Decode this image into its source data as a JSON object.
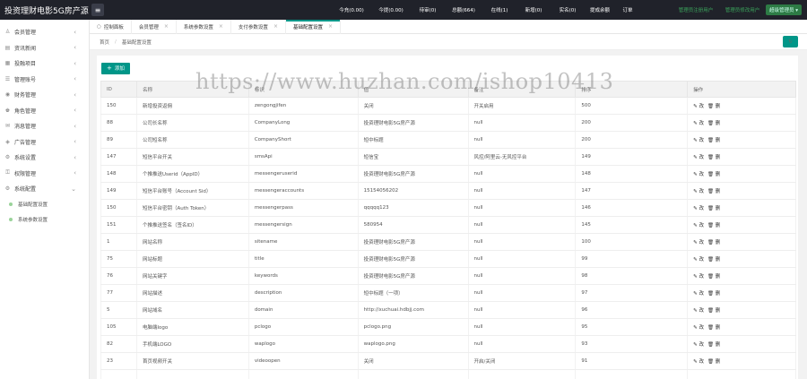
{
  "app": {
    "title": "投资理财电影5G房产源"
  },
  "topbar": {
    "stats": [
      {
        "label": "今充(0.00)"
      },
      {
        "label": "今提(0.00)"
      },
      {
        "label": "待审(0)"
      },
      {
        "label": "总额(664)"
      },
      {
        "label": "在线(1)"
      },
      {
        "label": "新增(0)"
      },
      {
        "label": "实名(0)"
      },
      {
        "label": "提成余额"
      },
      {
        "label": "订单"
      }
    ],
    "green_links": [
      "管理员注册用户",
      "管理员修改用户"
    ],
    "user": "超级管理员"
  },
  "sidebar": {
    "items": [
      {
        "label": "会员管理",
        "icon": "user-icon"
      },
      {
        "label": "资讯新闻",
        "icon": "news-icon"
      },
      {
        "label": "投融项目",
        "icon": "project-icon"
      },
      {
        "label": "管理账号",
        "icon": "account-icon"
      },
      {
        "label": "财务管理",
        "icon": "finance-icon"
      },
      {
        "label": "角色管理",
        "icon": "role-icon"
      },
      {
        "label": "消息管理",
        "icon": "message-icon"
      },
      {
        "label": "广告管理",
        "icon": "ad-icon"
      },
      {
        "label": "系统设置",
        "icon": "settings-icon"
      },
      {
        "label": "权限管理",
        "icon": "permission-icon"
      },
      {
        "label": "系统配置",
        "icon": "config-icon"
      }
    ],
    "sub_items": [
      {
        "label": "基础配置设置"
      },
      {
        "label": "系统参数设置"
      }
    ]
  },
  "tabs": [
    {
      "label": "控制面板",
      "home": true
    },
    {
      "label": "会员管理"
    },
    {
      "label": "系统参数设置"
    },
    {
      "label": "支付参数设置"
    },
    {
      "label": "基础配置设置",
      "active": true
    }
  ],
  "breadcrumb": {
    "home": "首页",
    "current": "基础配置设置"
  },
  "toolbar": {
    "add_label": "添加"
  },
  "table": {
    "headers": [
      "ID",
      "名称",
      "标识",
      "值",
      "备注",
      "排序",
      "操作"
    ],
    "rows": [
      [
        "150",
        "新增投资返佣",
        "zengongjifen",
        "关闭",
        "开关启用",
        "500"
      ],
      [
        "88",
        "公司长名称",
        "CompanyLong",
        "投资理财电影5G房产源",
        "null",
        "200"
      ],
      [
        "89",
        "公司短名称",
        "CompanyShort",
        "短中标题",
        "null",
        "200"
      ],
      [
        "147",
        "短信平台开关",
        "smsApi",
        "短信宝",
        "风控/阿里云-无风控平台",
        "149"
      ],
      [
        "148",
        "个推推送Userid（AppID）",
        "messengeruserid",
        "投资理财电影5G房产源",
        "null",
        "148"
      ],
      [
        "149",
        "短信平台账号（Account Sid）",
        "messengeraccounts",
        "15154056202",
        "null",
        "147"
      ],
      [
        "150",
        "短信平台密钥（Auth Token）",
        "messengerpass",
        "qqqqq123",
        "null",
        "146"
      ],
      [
        "151",
        "个推推送签名（签名ID）",
        "messengersign",
        "580954",
        "null",
        "145"
      ],
      [
        "1",
        "网站名称",
        "sitename",
        "投资理财电影5G房产源",
        "null",
        "100"
      ],
      [
        "75",
        "网站标题",
        "title",
        "投资理财电影5G房产源",
        "null",
        "99"
      ],
      [
        "76",
        "网站关键字",
        "keywords",
        "投资理财电影5G房产源",
        "null",
        "98"
      ],
      [
        "77",
        "网站描述",
        "description",
        "短中标题（一项）",
        "null",
        "97"
      ],
      [
        "5",
        "网站域名",
        "domain",
        "http://xuchuai.hdbjj.com",
        "null",
        "96"
      ],
      [
        "105",
        "电脑端logo",
        "pclogo",
        "pclogo.png",
        "null",
        "95"
      ],
      [
        "82",
        "手机端LOGO",
        "waplogo",
        "waplogo.png",
        "null",
        "93"
      ],
      [
        "23",
        "首页视频开关",
        "videoopen",
        "关闭",
        "开启/关闭",
        "91"
      ],
      [
        "",
        "",
        "",
        "",
        "",
        ""
      ]
    ],
    "op_edit": "✎ 改",
    "op_del": "🗑 删"
  },
  "watermark": "https://www.huzhan.com/ishop10413",
  "colors": {
    "accent": "#009688",
    "topbar": "#20222a",
    "green_link": "#3ba55c"
  }
}
